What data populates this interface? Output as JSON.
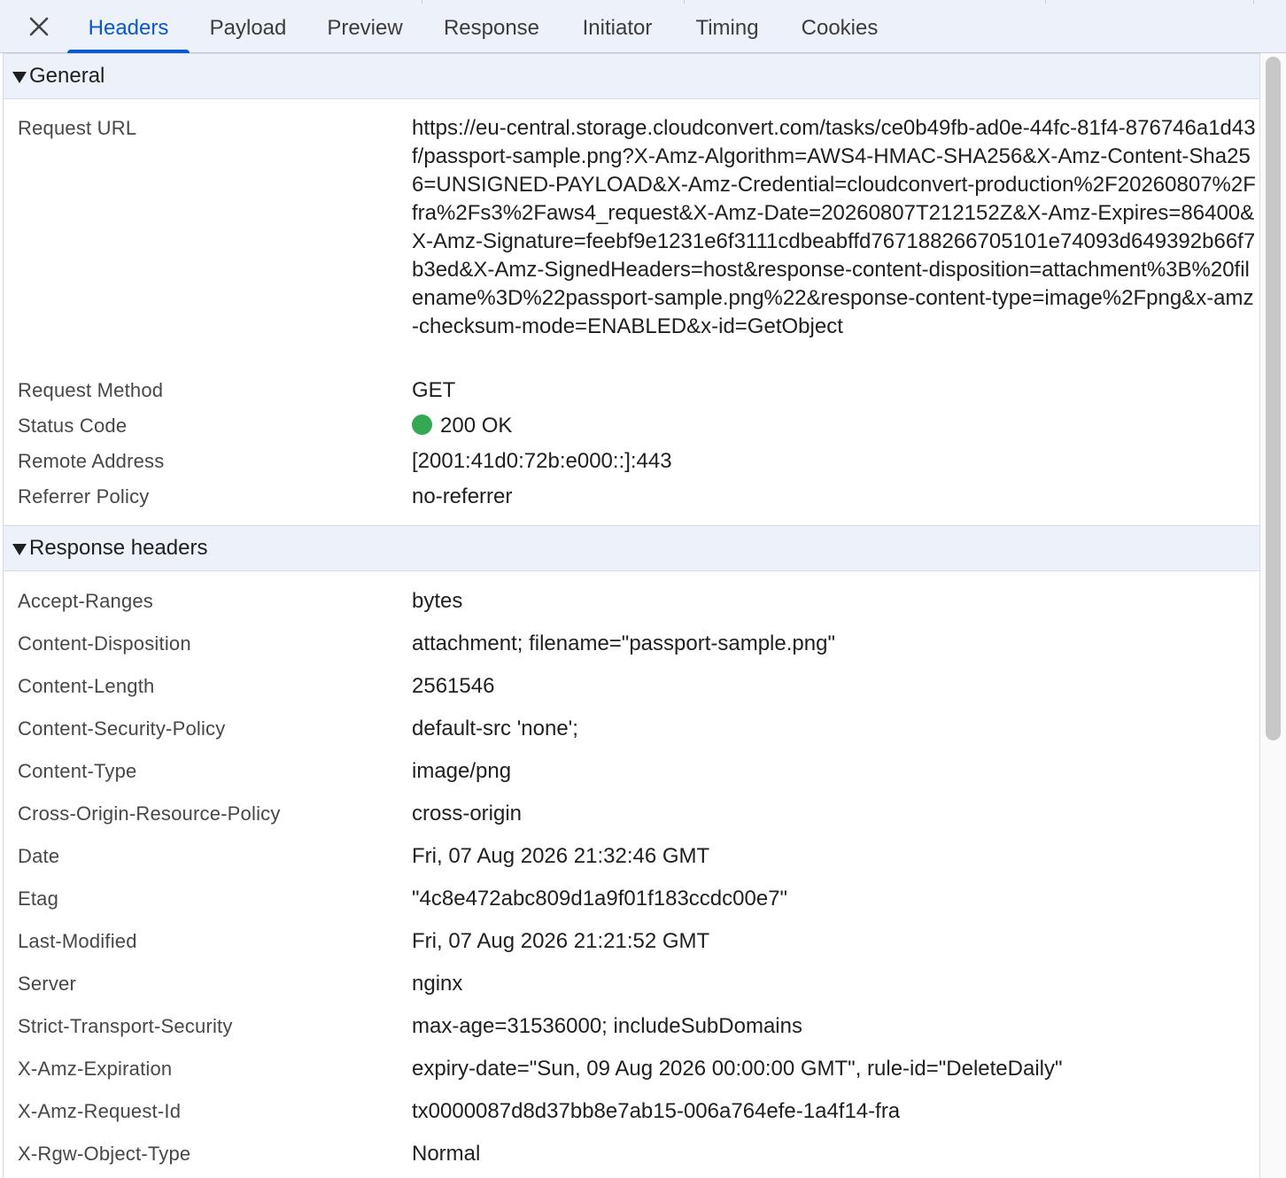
{
  "tabs": [
    {
      "label": "Headers",
      "active": true
    },
    {
      "label": "Payload"
    },
    {
      "label": "Preview"
    },
    {
      "label": "Response"
    },
    {
      "label": "Initiator"
    },
    {
      "label": "Timing"
    },
    {
      "label": "Cookies"
    }
  ],
  "colors": {
    "accent": "#0b57d0",
    "status_ok": "#34a853",
    "header_bg": "#edf2fa"
  },
  "general": {
    "title": "General",
    "request_url_label": "Request URL",
    "request_url": "https://eu-central.storage.cloudconvert.com/tasks/ce0b49fb-ad0e-44fc-81f4-876746a1d43f/passport-sample.png?X-Amz-Algorithm=AWS4-HMAC-SHA256&X-Amz-Content-Sha256=UNSIGNED-PAYLOAD&X-Amz-Credential=cloudconvert-production%2F20260807%2Ffra%2Fs3%2Faws4_request&X-Amz-Date=20260807T212152Z&X-Amz-Expires=86400&X-Amz-Signature=feebf9e1231e6f3111cdbeabffd767188266705101e74093d649392b66f7b3ed&X-Amz-SignedHeaders=host&response-content-disposition=attachment%3B%20filename%3D%22passport-sample.png%22&response-content-type=image%2Fpng&x-amz-checksum-mode=ENABLED&x-id=GetObject",
    "method_label": "Request Method",
    "method": "GET",
    "status_label": "Status Code",
    "status": "200 OK",
    "remote_label": "Remote Address",
    "remote": "[2001:41d0:72b:e000::]:443",
    "referrer_label": "Referrer Policy",
    "referrer": "no-referrer"
  },
  "response": {
    "title": "Response headers",
    "rows": [
      {
        "k": "Accept-Ranges",
        "v": "bytes"
      },
      {
        "k": "Content-Disposition",
        "v": "attachment; filename=\"passport-sample.png\""
      },
      {
        "k": "Content-Length",
        "v": "2561546"
      },
      {
        "k": "Content-Security-Policy",
        "v": "default-src 'none';"
      },
      {
        "k": "Content-Type",
        "v": "image/png"
      },
      {
        "k": "Cross-Origin-Resource-Policy",
        "v": "cross-origin"
      },
      {
        "k": "Date",
        "v": "Fri, 07 Aug 2026 21:32:46 GMT"
      },
      {
        "k": "Etag",
        "v": "\"4c8e472abc809d1a9f01f183ccdc00e7\""
      },
      {
        "k": "Last-Modified",
        "v": "Fri, 07 Aug 2026 21:21:52 GMT"
      },
      {
        "k": "Server",
        "v": "nginx"
      },
      {
        "k": "Strict-Transport-Security",
        "v": "max-age=31536000; includeSubDomains"
      },
      {
        "k": "X-Amz-Expiration",
        "v": "expiry-date=\"Sun, 09 Aug 2026 00:00:00 GMT\", rule-id=\"DeleteDaily\""
      },
      {
        "k": "X-Amz-Request-Id",
        "v": "tx0000087d8d37bb8e7ab15-006a764efe-1a4f14-fra"
      },
      {
        "k": "X-Rgw-Object-Type",
        "v": "Normal"
      }
    ]
  }
}
